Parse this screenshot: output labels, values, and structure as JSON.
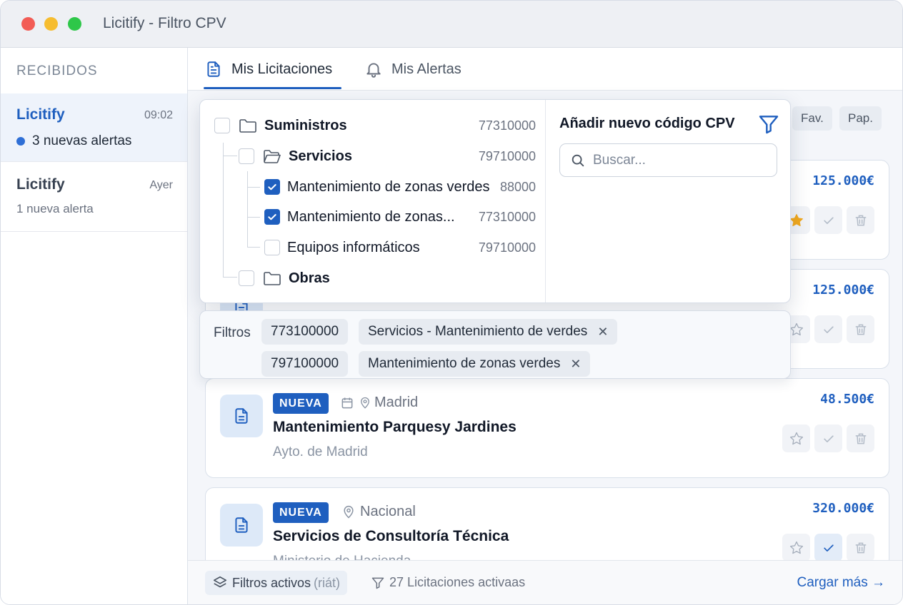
{
  "window": {
    "title": "Licitify - Filtro CPV"
  },
  "sidebar": {
    "heading": "RECIBIDOS",
    "items": [
      {
        "name": "Licitify",
        "time": "09:02",
        "subtitle": "3 nuevas alertas",
        "unread": true
      },
      {
        "name": "Licitify",
        "time": "Ayer",
        "subtitle": "1 nueva alerta",
        "unread": false
      }
    ]
  },
  "tabs": [
    {
      "label": "Mis Licitaciones",
      "icon": "document-icon",
      "active": true
    },
    {
      "label": "Mis Alertas",
      "icon": "bell-icon",
      "active": false
    }
  ],
  "toolbar": {
    "fav_label": "Fav.",
    "pap_label": "Pap."
  },
  "cards": [
    {
      "price": "125.000€",
      "starred": true,
      "checked": false
    },
    {
      "price": "125.000€",
      "starred": false,
      "checked": false
    },
    {
      "badge": "NUEVA",
      "location": "Madrid",
      "title": "Mantenimiento Parquesy Jardines",
      "subtitle": "Ayto. de Madrid",
      "price": "48.500€",
      "starred": false,
      "checked": false
    },
    {
      "badge": "NUEVA",
      "location": "Nacional",
      "title": "Servicios de Consultoría Técnica",
      "subtitle": "Ministerio de Hacienda",
      "price": "320.000€",
      "starred": false,
      "checked": true
    }
  ],
  "cpv_tree": [
    {
      "label": "Suministros",
      "code": "77310000",
      "checked": false
    },
    {
      "label": "Servicios",
      "code": "79710000",
      "checked": false
    },
    {
      "label": "Mantenimiento de zonas verdes",
      "code": "88000",
      "checked": true
    },
    {
      "label": "Mantenimiento de zonas...",
      "code": "77310000",
      "checked": true
    },
    {
      "label": "Equipos informáticos",
      "code": "79710000",
      "checked": false
    },
    {
      "label": "Obras",
      "code": "",
      "checked": false
    }
  ],
  "cpv_panel": {
    "heading": "Añadir nuevo código CPV",
    "search_placeholder": "Buscar..."
  },
  "active_filters": {
    "label": "Filtros",
    "rows": [
      {
        "code": "773100000",
        "name": "Servicios - Mantenimiento de verdes"
      },
      {
        "code": "797100000",
        "name": "Mantenimiento de zonas verdes"
      }
    ],
    "remove_glyph": "✕"
  },
  "footer": {
    "active_label": "Filtros activos",
    "active_note": "(riát)",
    "count_label": "27 Licitaciones activaas",
    "more_label": "Cargar más →"
  },
  "colors": {
    "accent": "#1f5fbf",
    "star": "#f2a81d"
  }
}
